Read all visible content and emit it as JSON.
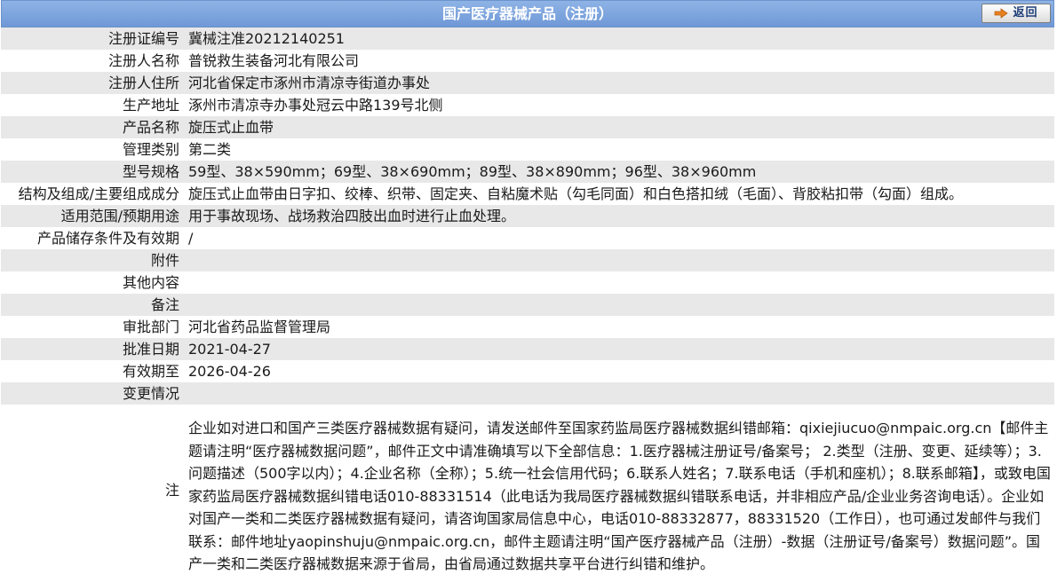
{
  "header": {
    "title": "国产医疗器械产品（注册）",
    "back_label": "返回"
  },
  "rows": [
    {
      "label": "注册证编号",
      "value": "冀械注准20212140251"
    },
    {
      "label": "注册人名称",
      "value": "普锐救生装备河北有限公司"
    },
    {
      "label": "注册人住所",
      "value": "河北省保定市涿州市清凉寺街道办事处"
    },
    {
      "label": "生产地址",
      "value": "涿州市清凉寺办事处冠云中路139号北侧"
    },
    {
      "label": "产品名称",
      "value": "旋压式止血带"
    },
    {
      "label": "管理类别",
      "value": "第二类"
    },
    {
      "label": "型号规格",
      "value": "59型、38×590mm；69型、38×690mm；89型、38×890mm；96型、38×960mm"
    },
    {
      "label": "结构及组成/主要组成成分",
      "value": "旋压式止血带由日字扣、绞棒、织带、固定夹、自粘魔术贴（勾毛同面）和白色搭扣绒（毛面）、背胶粘扣带（勾面）组成。"
    },
    {
      "label": "适用范围/预期用途",
      "value": "用于事故现场、战场救治四肢出血时进行止血处理。"
    },
    {
      "label": "产品储存条件及有效期",
      "value": "/"
    },
    {
      "label": "附件",
      "value": ""
    },
    {
      "label": "其他内容",
      "value": ""
    },
    {
      "label": "备注",
      "value": ""
    },
    {
      "label": "审批部门",
      "value": "河北省药品监督管理局"
    },
    {
      "label": "批准日期",
      "value": "2021-04-27"
    },
    {
      "label": "有效期至",
      "value": "2026-04-26"
    },
    {
      "label": "变更情况",
      "value": ""
    }
  ],
  "note": {
    "label": "注",
    "text": "企业如对进口和国产三类医疗器械数据有疑问，请发送邮件至国家药监局医疗器械数据纠错邮箱：qixiejiucuo@nmpaic.org.cn【邮件主题请注明“医疗器械数据问题”，邮件正文中请准确填写以下全部信息：1.医疗器械注册证号/备案号； 2.类型（注册、变更、延续等）；3.问题描述（500字以内）；4.企业名称（全称）；5.统一社会信用代码；6.联系人姓名；7.联系电话（手机和座机）；8.联系邮箱】，或致电国家药监局医疗器械数据纠错电话010-88331514（此电话为我局医疗器械数据纠错联系电话，并非相应产品/企业业务咨询电话）。企业如对国产一类和二类医疗器械数据有疑问，请咨询国家局信息中心，电话010-88332877，88331520（工作日），也可通过发邮件与我们联系：邮件地址yaopinshuju@nmpaic.org.cn，邮件主题请注明“国产医疗器械产品（注册）-数据（注册证号/备案号）数据问题”。国产一类和二类医疗器械数据来源于省局，由省局通过数据共享平台进行纠错和维护。"
  },
  "colors": {
    "header_top": "#8eb3e6",
    "header_bottom": "#6f98d6",
    "row_alt": "#e8e8e8",
    "row_plain": "#ffffff",
    "back_arrow": "#e8821e"
  }
}
